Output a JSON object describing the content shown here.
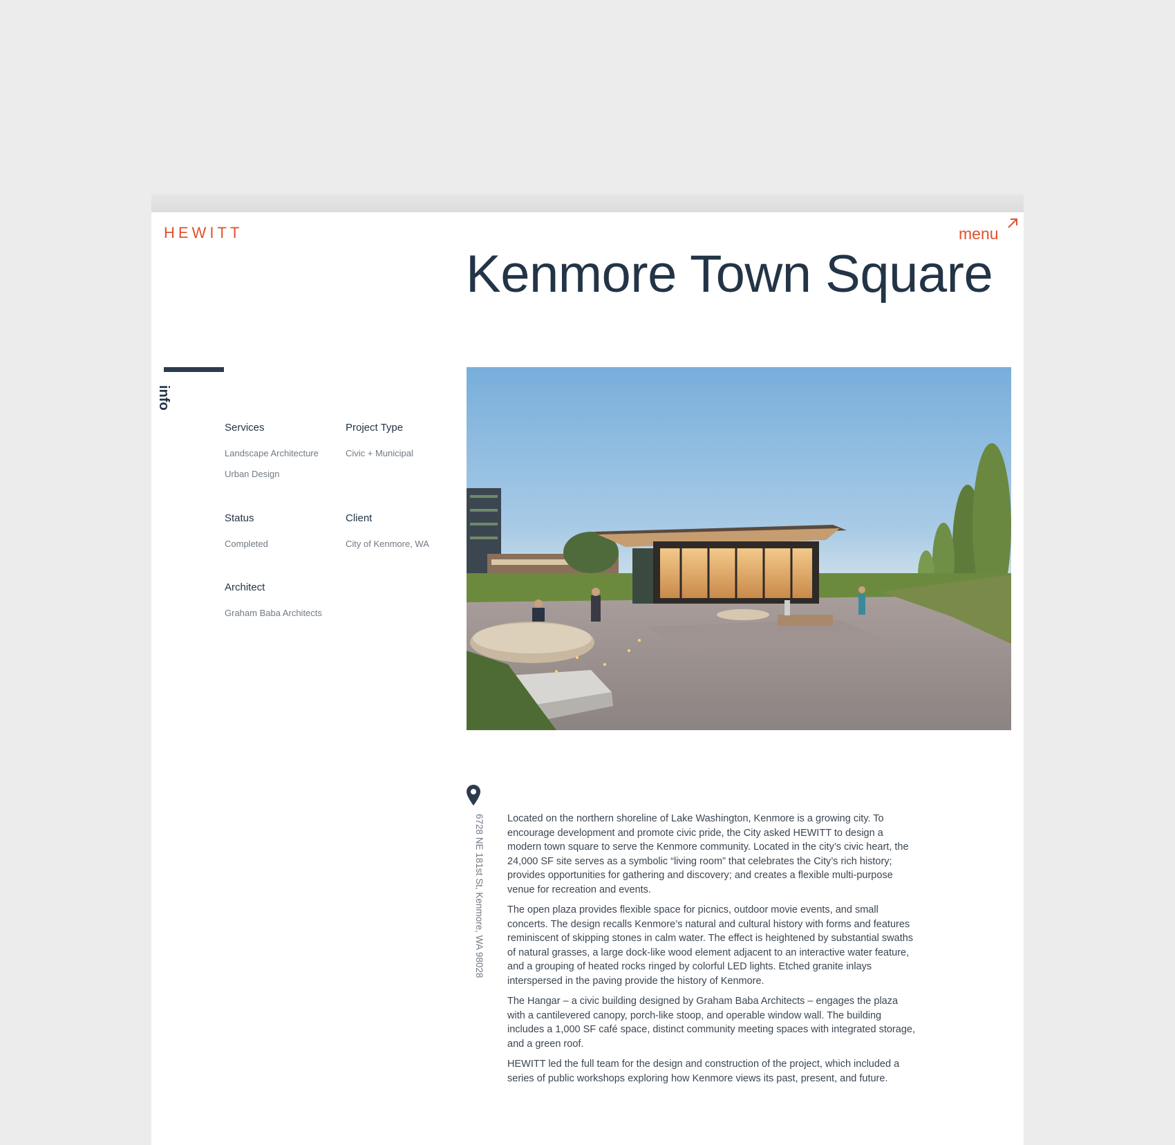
{
  "header": {
    "logo": "HEWITT",
    "menu_label": "menu"
  },
  "project": {
    "title": "Kenmore Town Square",
    "info_label": "info",
    "fields": {
      "services": {
        "label": "Services",
        "values": [
          "Landscape Architecture",
          "Urban Design"
        ]
      },
      "project_type": {
        "label": "Project Type",
        "values": [
          "Civic + Municipal"
        ]
      },
      "status": {
        "label": "Status",
        "values": [
          "Completed"
        ]
      },
      "client": {
        "label": "Client",
        "values": [
          "City of Kenmore, WA"
        ]
      },
      "architect": {
        "label": "Architect",
        "values": [
          "Graham Baba Architects"
        ]
      }
    },
    "address": "6728 NE 181st St, Kenmore, WA 98028",
    "description": [
      "Located on the northern shoreline of Lake Washington, Kenmore is a growing city. To encourage development and promote civic pride, the City asked HEWITT to design a modern town square to serve the Kenmore community. Located in the city’s civic heart, the 24,000 SF site serves as a symbolic “living room” that celebrates the City’s rich history; provides opportunities for gathering and discovery; and creates a flexible multi-purpose venue for recreation and events.",
      "The open plaza provides flexible space for picnics, outdoor movie events, and small concerts. The design recalls Kenmore’s natural and cultural history with forms and features reminiscent of skipping stones in calm water. The effect is heightened by substantial swaths of natural grasses, a large dock-like wood element adjacent to an interactive water feature, and a grouping of heated rocks ringed by colorful LED lights. Etched granite inlays interspersed  in the paving provide the history of Kenmore.",
      "The Hangar – a civic building designed by Graham Baba Architects – engages the plaza with a cantilevered canopy, porch-like stoop, and operable window wall. The building includes a 1,000 SF café space, distinct community meeting spaces with integrated storage, and a green roof.",
      "HEWITT led the full team for the design and construction of the project, which included a series of public workshops exploring how Kenmore views its past, present, and future."
    ]
  },
  "colors": {
    "accent": "#e2502a",
    "navy": "#233447",
    "muted": "#707a84"
  },
  "icons": {
    "menu": "arrow-up-right-icon",
    "location": "map-pin-icon"
  }
}
